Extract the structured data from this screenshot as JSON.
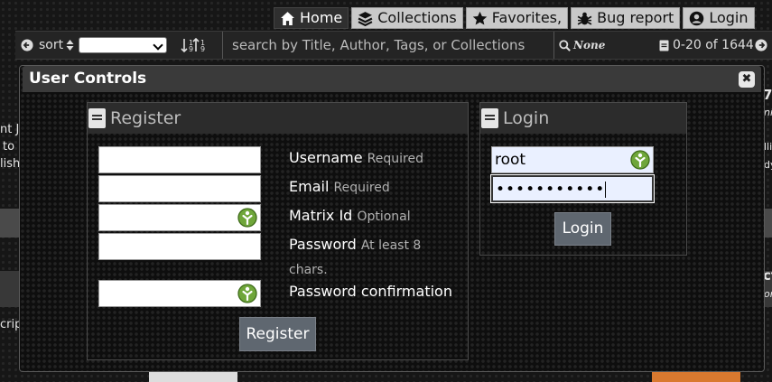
{
  "nav": {
    "home": "Home",
    "collections": "Collections",
    "favorites": "Favorites,",
    "bug_report": "Bug report",
    "login": "Login"
  },
  "toolbar": {
    "sort_label": "sort",
    "search_placeholder": "search by Title, Author, Tags, or Collections",
    "none_label": "None",
    "range": "0-20 of 1644"
  },
  "background": {
    "left_lines": [
      "nt J",
      "to",
      "lish",
      "crip"
    ],
    "right_lines": [
      "7(",
      "nil",
      "lli",
      "dy",
      "ct",
      "or"
    ]
  },
  "modal": {
    "title": "User Controls",
    "register": {
      "heading": "Register",
      "username_label": "Username",
      "username_hint": "Required",
      "email_label": "Email",
      "email_hint": "Required",
      "matrix_label": "Matrix Id",
      "matrix_hint": "Optional",
      "password_label": "Password",
      "password_hint": "At least 8",
      "password_hint2": "chars.",
      "confirm_label": "Password confirmation",
      "button": "Register"
    },
    "login": {
      "heading": "Login",
      "username_value": "root",
      "password_value": "•••••••••••",
      "button": "Login"
    }
  }
}
